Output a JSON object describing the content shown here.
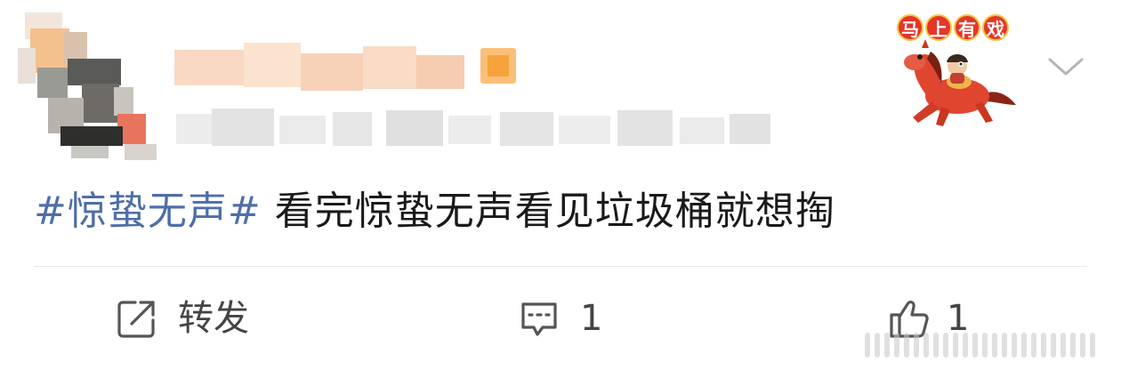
{
  "post": {
    "topic": "#惊蛰无声#",
    "body": " 看完惊蛰无声看见垃圾桶就想掏"
  },
  "pendant": {
    "chars": [
      "马",
      "上",
      "有",
      "戏"
    ]
  },
  "actions": {
    "repost_label": "转发",
    "comment_count": "1",
    "like_count": "1"
  },
  "icons": {
    "more": "chevron-down-icon",
    "repost": "repost-icon",
    "comment": "comment-icon",
    "like": "thumbs-up-icon"
  },
  "colors": {
    "topic_link": "#4e6ea8",
    "text": "#1a1a1a",
    "action_text": "#444444",
    "divider": "#e8e8e8"
  }
}
